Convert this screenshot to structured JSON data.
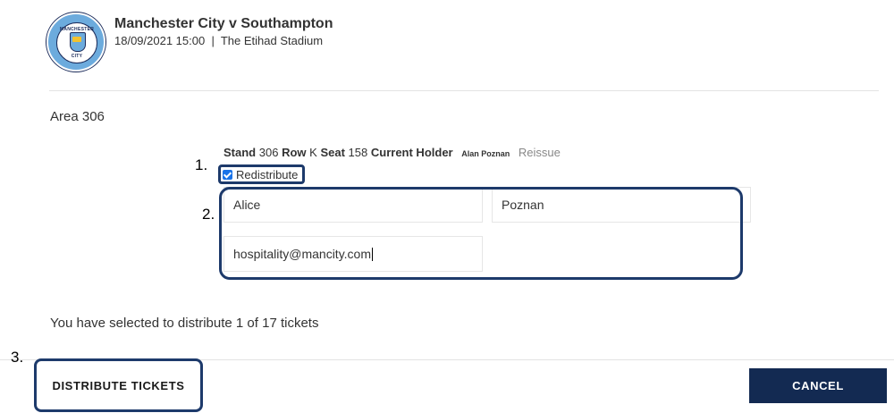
{
  "match": {
    "title": "Manchester City v Southampton",
    "datetime": "18/09/2021 15:00",
    "separator": "|",
    "venue": "The Etihad Stadium",
    "crest_text_top": "MANCHESTER",
    "crest_text_bottom": "CITY"
  },
  "area": {
    "label": "Area 306"
  },
  "seat": {
    "stand_label": "Stand",
    "stand_value": "306",
    "row_label": "Row",
    "row_value": "K",
    "seat_label": "Seat",
    "seat_value": "158",
    "holder_label": "Current Holder",
    "holder_value": "Alan Poznan",
    "reissue_label": "Reissue"
  },
  "redistribute": {
    "label": "Redistribute",
    "checked": true
  },
  "form": {
    "first_name": "Alice",
    "last_name": "Poznan",
    "email": "hospitality@mancity.com"
  },
  "annotations": {
    "step1": "1.",
    "step2": "2.",
    "step3": "3."
  },
  "summary": {
    "text": "You have selected to distribute 1 of 17 tickets"
  },
  "actions": {
    "distribute_label": "DISTRIBUTE TICKETS",
    "cancel_label": "CANCEL"
  },
  "colors": {
    "primary_navy": "#132a52",
    "annotation_border": "#1d3a6b",
    "crest_blue": "#6cabdd",
    "checkbox_blue": "#1a73e8"
  }
}
